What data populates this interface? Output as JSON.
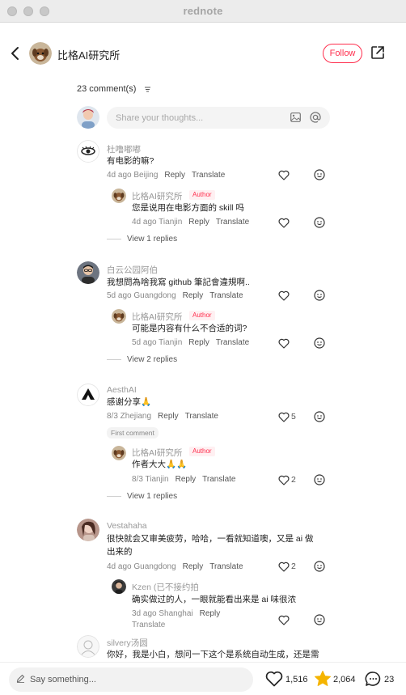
{
  "app": {
    "title": "rednote"
  },
  "colors": {
    "accent": "#ff2e4d",
    "star": "#f5b400"
  },
  "header": {
    "author_name": "比格AI研究所",
    "follow_label": "Follow"
  },
  "comments_header": {
    "count_label": "23 comment(s)"
  },
  "share_input": {
    "placeholder": "Share your thoughts..."
  },
  "actions": {
    "reply": "Reply",
    "translate": "Translate"
  },
  "comments": [
    {
      "name": "杜噜嘟嘟",
      "text": "有电影的嘛?",
      "meta": "4d ago Beijing",
      "reply": {
        "name": "比格AI研究所",
        "tag": "Author",
        "text": "您是说用在电影方面的 skill 吗",
        "meta": "4d ago Tianjin"
      },
      "view_replies": "View 1 replies"
    },
    {
      "name": "白云公园阿伯",
      "text": "我想問為啥我寫 github 筆記會違規啊..",
      "meta": "5d ago Guangdong",
      "reply": {
        "name": "比格AI研究所",
        "tag": "Author",
        "text": "可能是内容有什么不合适的词?",
        "meta": "5d ago Tianjin"
      },
      "view_replies": "View 2 replies"
    },
    {
      "name": "AesthAI",
      "text": "感谢分享🙏",
      "meta": "8/3 Zhejiang",
      "likes": "5",
      "first_tag": "First comment",
      "reply": {
        "name": "比格AI研究所",
        "tag": "Author",
        "text": "作者大大🙏🙏",
        "meta": "8/3 Tianjin",
        "likes": "2"
      },
      "view_replies": "View 1 replies"
    },
    {
      "name": "Vestahaha",
      "text_line1": "很快就会又审美疲劳，哈哈，一看就知道噢，又是 ai 做",
      "text_line2": "出来的",
      "meta": "4d ago Guangdong",
      "likes": "2",
      "reply": {
        "name": "Kzen (已不接约拍",
        "text": "确实做过的人，一眼就能看出来是 ai 味很浓",
        "meta": "3d ago Shanghai"
      }
    },
    {
      "name": "silvery汤圆",
      "text": "你好，我是小白，想问一下这个是系统自动生成，还是需"
    }
  ],
  "bottom": {
    "placeholder": "Say something...",
    "likes": "1,516",
    "stars": "2,064",
    "comments": "23"
  }
}
